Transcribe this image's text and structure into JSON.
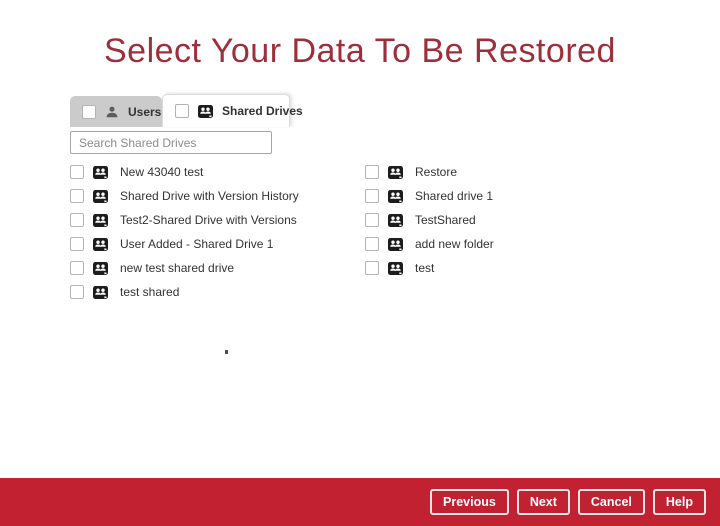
{
  "page": {
    "title": "Select Your Data To Be Restored"
  },
  "colors": {
    "accent_red": "#C22132",
    "title_red": "#9E2F3A"
  },
  "tabs": [
    {
      "label": "Users",
      "icon": "user-icon",
      "active": false,
      "checked": false
    },
    {
      "label": "Shared Drives",
      "icon": "shared-drive-icon",
      "active": true,
      "checked": false
    }
  ],
  "search": {
    "placeholder": "Search Shared Drives",
    "value": ""
  },
  "drives": {
    "item_icon": "shared-drive-icon",
    "left_column": [
      "New 43040 test",
      "Shared Drive with Version History",
      "Test2-Shared Drive with Versions",
      "User Added - Shared Drive 1",
      "new test shared drive",
      "test shared"
    ],
    "right_column": [
      "Restore",
      "Shared drive 1",
      "TestShared",
      "add new folder",
      "test"
    ],
    "all_unchecked": true
  },
  "footer": {
    "buttons": [
      "Previous",
      "Next",
      "Cancel",
      "Help"
    ]
  }
}
